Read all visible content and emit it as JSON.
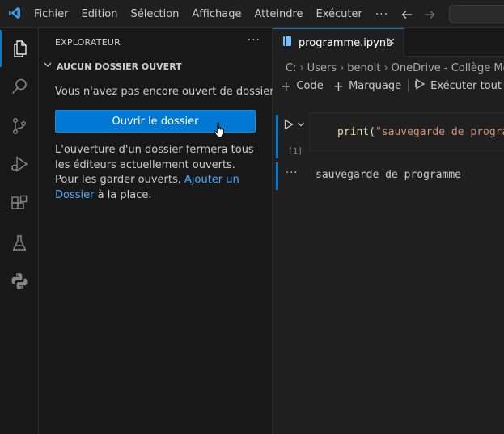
{
  "titlebar": {
    "menu": [
      "Fichier",
      "Edition",
      "Sélection",
      "Affichage",
      "Atteindre",
      "Exécuter"
    ],
    "more_icon": "ellipsis-icon",
    "back_icon": "arrow-left-icon",
    "forward_icon": "arrow-right-icon"
  },
  "activity_bar": {
    "items": [
      "explorer-icon",
      "search-icon",
      "source-control-icon",
      "run-debug-icon",
      "extensions-icon",
      "testing-icon",
      "python-icon"
    ]
  },
  "sidebar": {
    "header": "EXPLORATEUR",
    "section_title": "AUCUN DOSSIER OUVERT",
    "no_folder_text": "Vous n'avez pas encore ouvert de dossier.",
    "open_button": "Ouvrir le dossier",
    "info_before_link": "L'ouverture d'un dossier fermera tous les éditeurs actuellement ouverts. Pour les garder ouverts, ",
    "info_link": "Ajouter un Dossier",
    "info_after_link": " à la place."
  },
  "editor": {
    "tab_label": "programme.ipynb",
    "breadcrumb": [
      "C:",
      "Users",
      "benoit",
      "OneDrive - Collège Mont"
    ],
    "toolbar": {
      "add_code": "Code",
      "add_markdown": "Marquage",
      "run_all": "Exécuter tout"
    },
    "cell": {
      "exec_count": "[1]",
      "code_fn": "print",
      "code_open": "(",
      "code_string": "\"sauvegarde de progra",
      "output": "sauvegarde de programme"
    }
  },
  "colors": {
    "accent": "#0078d4",
    "link": "#4daafc",
    "string": "#ce9178",
    "function": "#dcdcaa"
  }
}
